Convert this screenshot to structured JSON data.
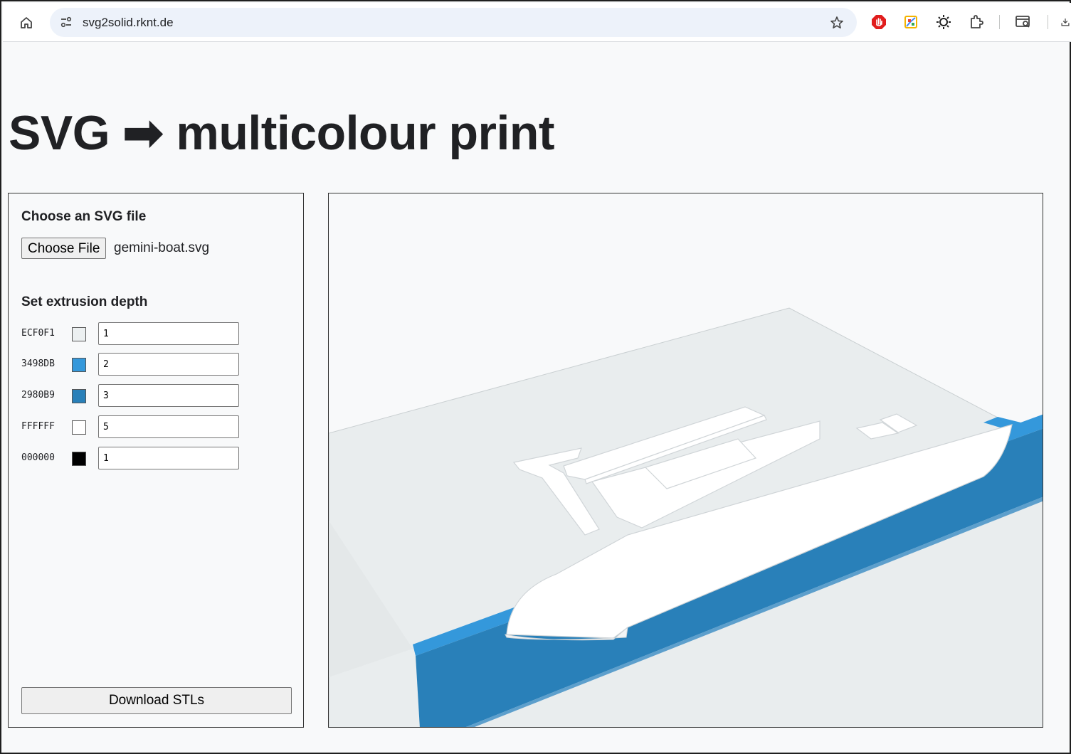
{
  "browser": {
    "url": "svg2solid.rknt.de",
    "icons": [
      "home-icon",
      "site-info-icon",
      "star-icon",
      "adblock-extension-icon",
      "color-picker-extension-icon",
      "sun-extension-icon",
      "extensions-puzzle-icon",
      "tab-search-icon",
      "downloads-icon"
    ]
  },
  "page": {
    "title": "SVG ➡ multicolour print"
  },
  "panel": {
    "file_heading": "Choose an SVG file",
    "choose_button": "Choose File",
    "file_name": "gemini-boat.svg",
    "depth_heading": "Set extrusion depth",
    "colors": [
      {
        "hex": "ECF0F1",
        "swatch": "#ECF0F1",
        "depth": "1"
      },
      {
        "hex": "3498DB",
        "swatch": "#3498DB",
        "depth": "2"
      },
      {
        "hex": "2980B9",
        "swatch": "#2980B9",
        "depth": "3"
      },
      {
        "hex": "FFFFFF",
        "swatch": "#FFFFFF",
        "depth": "5"
      },
      {
        "hex": "000000",
        "swatch": "#000000",
        "depth": "1"
      }
    ],
    "download_button": "Download STLs"
  },
  "preview": {
    "colors": {
      "base": "#ECF0F1",
      "water_light": "#3498DB",
      "water_dark": "#2980B9",
      "boat": "#FFFFFF",
      "outline": "#000000"
    }
  }
}
